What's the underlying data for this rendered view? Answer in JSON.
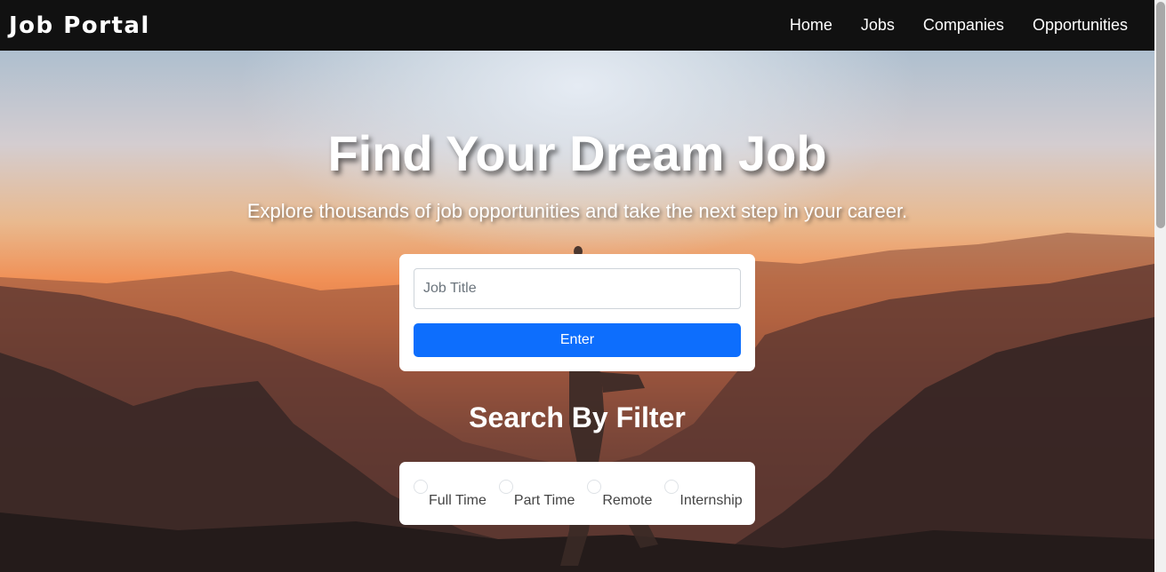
{
  "navbar": {
    "brand": "Job Portal",
    "links": [
      "Home",
      "Jobs",
      "Companies",
      "Opportunities"
    ]
  },
  "hero": {
    "title": "Find Your Dream Job",
    "subtitle": "Explore thousands of job opportunities and take the next step in your career."
  },
  "search": {
    "placeholder": "Job Title",
    "button_label": "Enter"
  },
  "filter": {
    "title": "Search By Filter",
    "options": [
      "Full Time",
      "Part Time",
      "Remote",
      "Internship"
    ]
  },
  "colors": {
    "navbar_bg": "#111111",
    "primary_button": "#0d6efd"
  }
}
